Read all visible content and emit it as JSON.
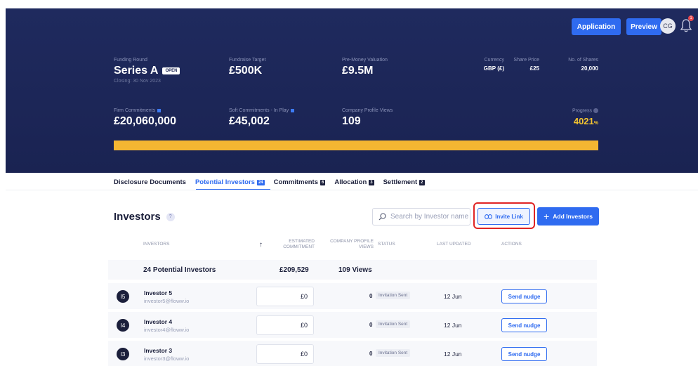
{
  "header": {
    "application_label": "Application",
    "preview_label": "Preview",
    "avatar_initials": "CG",
    "notification_count": "1"
  },
  "round": {
    "funding_round_label": "Funding Round",
    "funding_round_value": "Series A",
    "open_badge": "OPEN",
    "closing": "Closing: 30 Nov 2023",
    "fundraise_target_label": "Fundraise Target",
    "fundraise_target_value": "£500K",
    "pre_money_label": "Pre-Money Valuation",
    "pre_money_value": "£9.5M",
    "currency_label": "Currency",
    "currency_value": "GBP (£)",
    "share_price_label": "Share Price",
    "share_price_value": "£25",
    "shares_label": "No. of Shares",
    "shares_value": "20,000",
    "firm_label": "Firm Commitments",
    "firm_value": "£20,060,000",
    "soft_label": "Soft Commitments - In Play",
    "soft_value": "£45,002",
    "views_label": "Company Profile Views",
    "views_value": "109",
    "progress_label": "Progress",
    "progress_value": "4021",
    "progress_unit": "%",
    "progress_fill_percent": 100
  },
  "tabs": [
    {
      "label": "Disclosure Documents",
      "count": ""
    },
    {
      "label": "Potential Investors",
      "count": "24"
    },
    {
      "label": "Commitments",
      "count": "6"
    },
    {
      "label": "Allocation",
      "count": "3"
    },
    {
      "label": "Settlement",
      "count": "2"
    }
  ],
  "investors": {
    "title": "Investors",
    "help": "?",
    "search_placeholder": "Search by Investor name",
    "invite_label": "Invite Link",
    "add_label": "Add Investors",
    "columns": {
      "investors": "INVESTORS",
      "estimated_1": "ESTIMATED",
      "estimated_2": "COMMITMENT",
      "profile_1": "COMPANY PROFILE",
      "profile_2": "VIEWS",
      "status": "STATUS",
      "last_updated": "LAST UPDATED",
      "actions": "ACTIONS"
    },
    "summary": {
      "count": "24 Potential Investors",
      "commitment": "£209,529",
      "views": "109 Views"
    },
    "rows": [
      {
        "initials": "I5",
        "name": "Investor 5",
        "email": "investor5@floww.io",
        "commitment": "£0",
        "views": "0",
        "status": "Invitation Sent",
        "updated": "12 Jun",
        "action": "Send nudge"
      },
      {
        "initials": "I4",
        "name": "Investor 4",
        "email": "investor4@floww.io",
        "commitment": "£0",
        "views": "0",
        "status": "Invitation Sent",
        "updated": "12 Jun",
        "action": "Send nudge"
      },
      {
        "initials": "I3",
        "name": "Investor 3",
        "email": "investor3@floww.io",
        "commitment": "£0",
        "views": "0",
        "status": "Invitation Sent",
        "updated": "12 Jun",
        "action": "Send nudge"
      }
    ]
  }
}
